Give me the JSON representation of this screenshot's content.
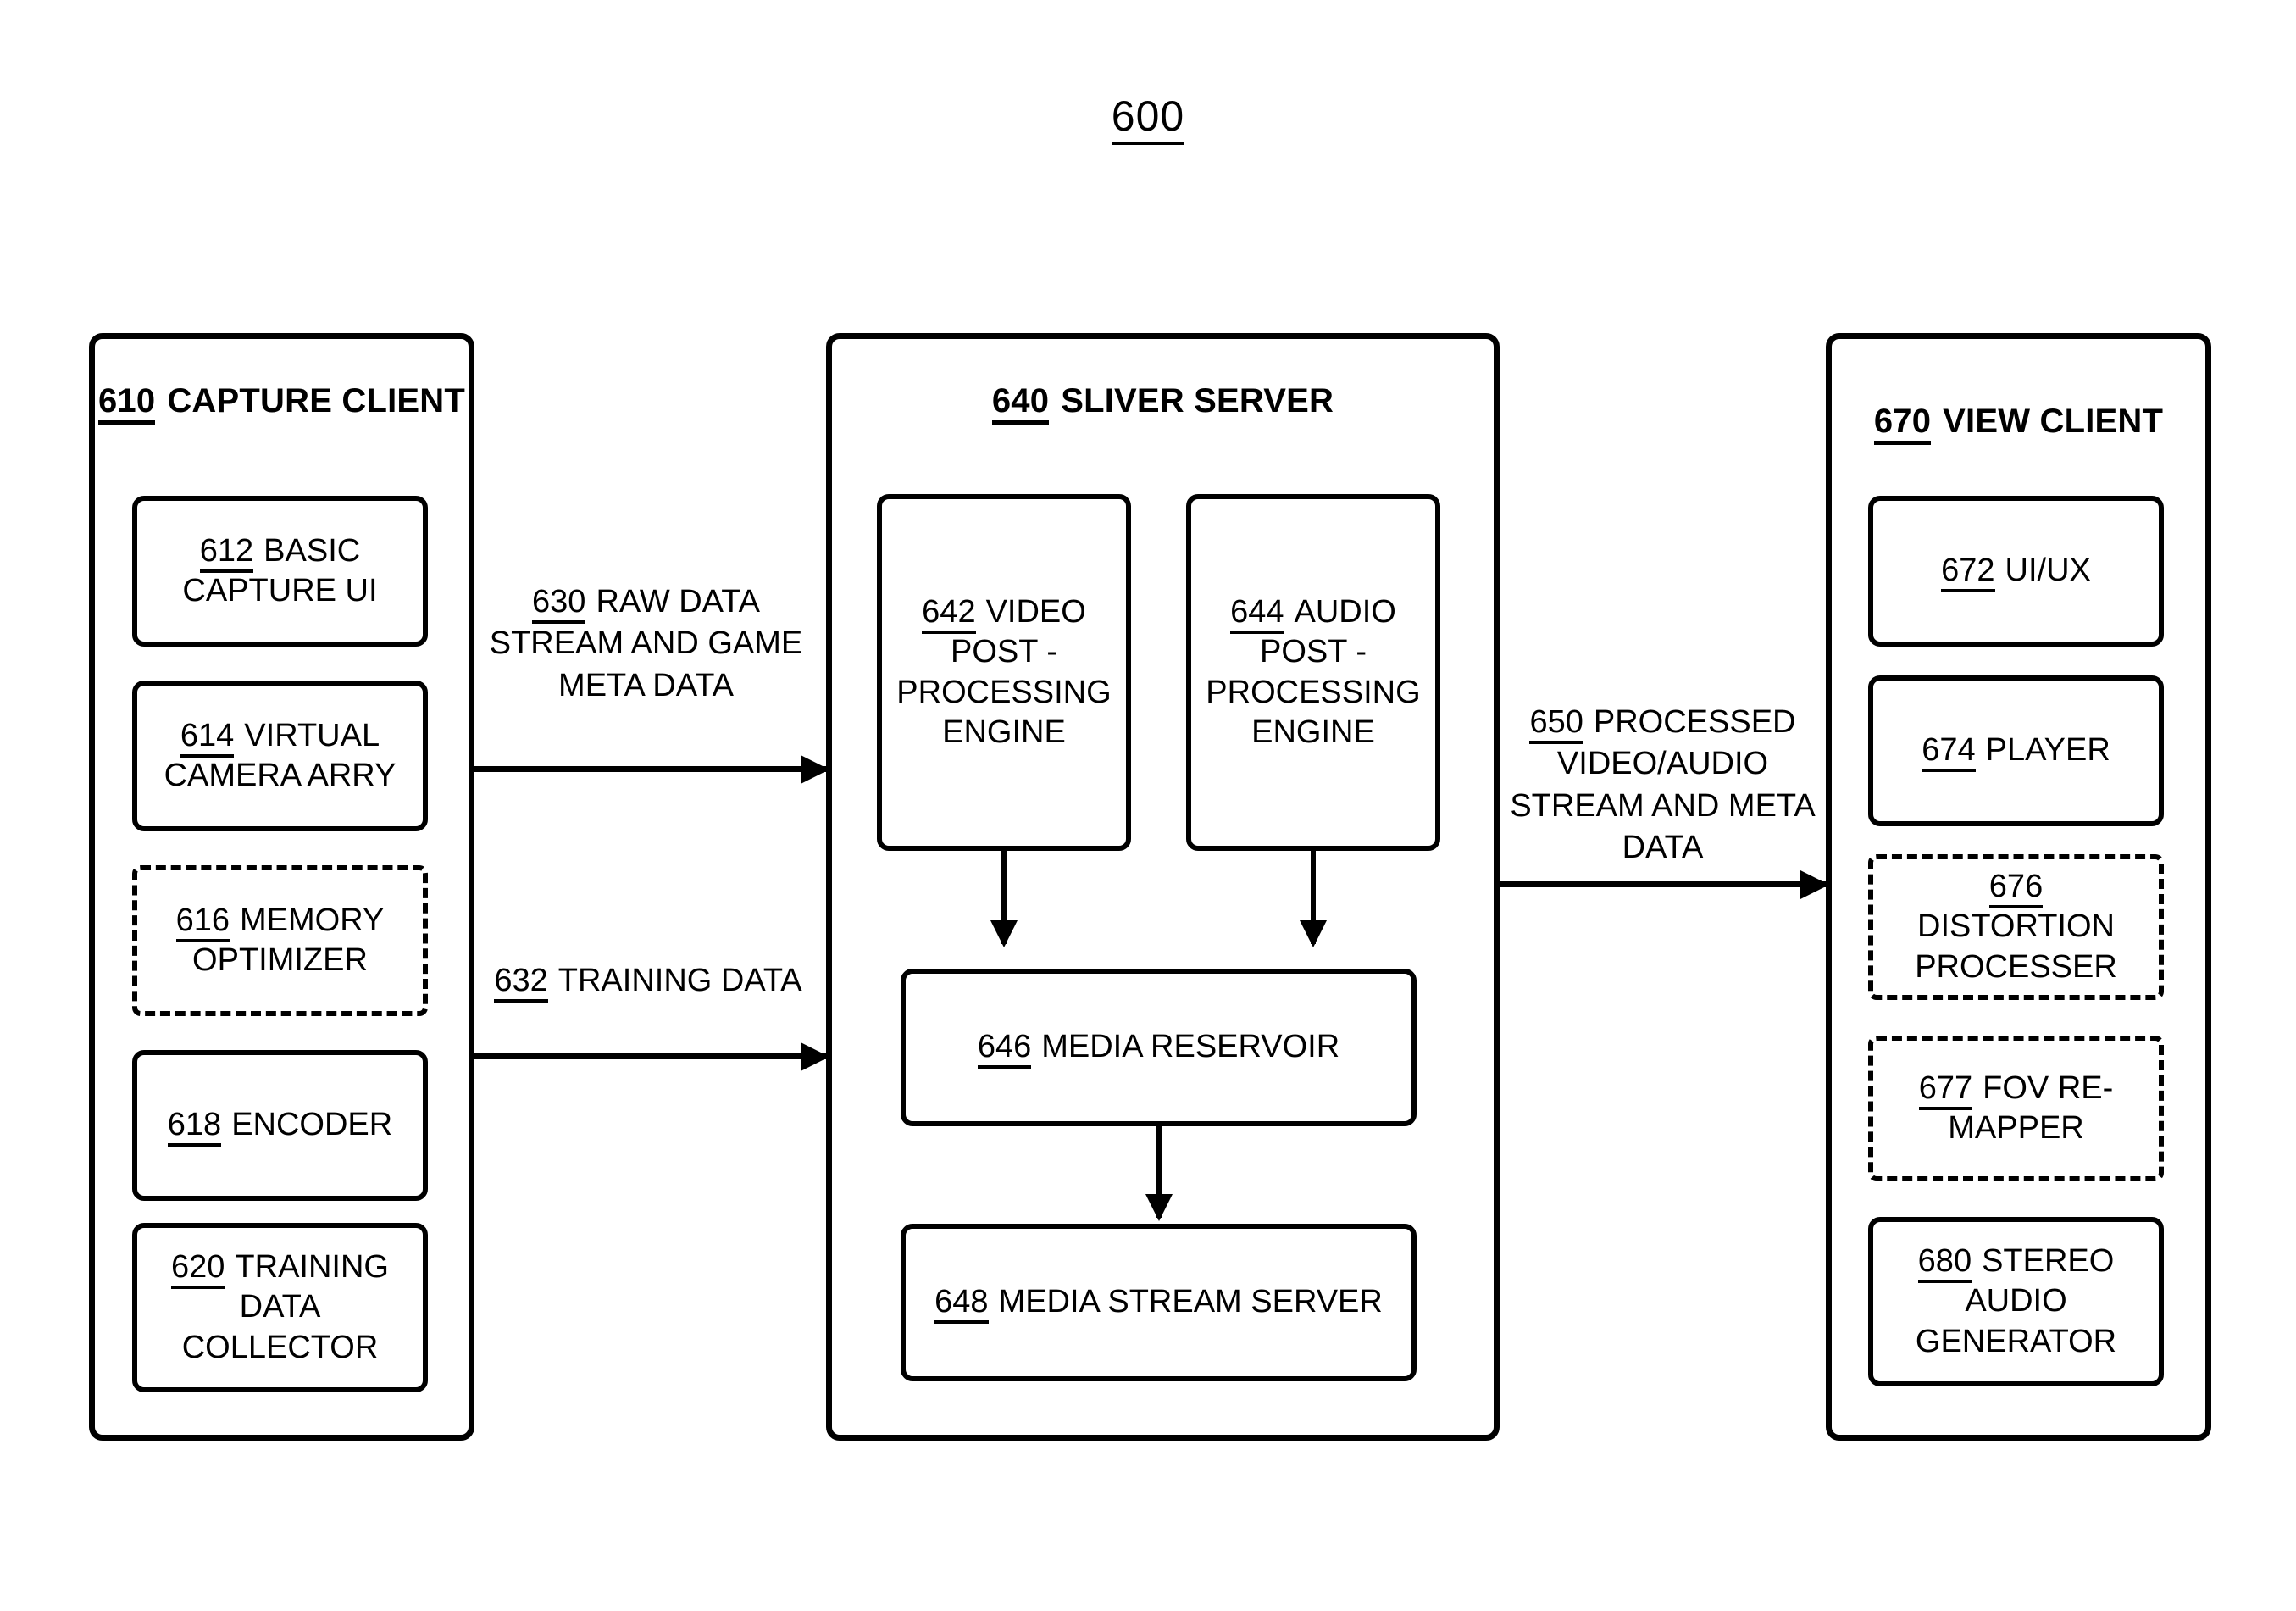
{
  "figure": {
    "number": "600"
  },
  "capture_client": {
    "ref": "610",
    "title": "CAPTURE CLIENT",
    "modules": [
      {
        "ref": "612",
        "label": "BASIC CAPTURE UI",
        "border": "solid"
      },
      {
        "ref": "614",
        "label": "VIRTUAL CAMERA ARRY",
        "border": "solid"
      },
      {
        "ref": "616",
        "label": "MEMORY OPTIMIZER",
        "border": "dashed"
      },
      {
        "ref": "618",
        "label": "ENCODER",
        "border": "solid"
      },
      {
        "ref": "620",
        "label": "TRAINING DATA COLLECTOR",
        "border": "solid"
      }
    ]
  },
  "sliver_server": {
    "ref": "640",
    "title": "SLIVER SERVER",
    "modules": [
      {
        "ref": "642",
        "label": "VIDEO POST - PROCESSING ENGINE",
        "border": "solid"
      },
      {
        "ref": "644",
        "label": "AUDIO POST - PROCESSING ENGINE",
        "border": "solid"
      },
      {
        "ref": "646",
        "label": "MEDIA RESERVOIR",
        "border": "solid"
      },
      {
        "ref": "648",
        "label": "MEDIA STREAM SERVER",
        "border": "solid"
      }
    ]
  },
  "view_client": {
    "ref": "670",
    "title": "VIEW CLIENT",
    "modules": [
      {
        "ref": "672",
        "label": "UI/UX",
        "border": "solid"
      },
      {
        "ref": "674",
        "label": "PLAYER",
        "border": "solid"
      },
      {
        "ref": "676",
        "label": "DISTORTION PROCESSER",
        "border": "dashed"
      },
      {
        "ref": "677",
        "label": "FOV RE-MAPPER",
        "border": "dashed"
      },
      {
        "ref": "680",
        "label": "STEREO AUDIO GENERATOR",
        "border": "solid"
      }
    ]
  },
  "flows": [
    {
      "ref": "630",
      "label": "RAW DATA STREAM AND GAME META DATA"
    },
    {
      "ref": "632",
      "label": "TRAINING DATA"
    },
    {
      "ref": "650",
      "label": "PROCESSED VIDEO/AUDIO STREAM AND META DATA"
    }
  ],
  "colors": {
    "line": "#000000",
    "background": "#ffffff"
  }
}
